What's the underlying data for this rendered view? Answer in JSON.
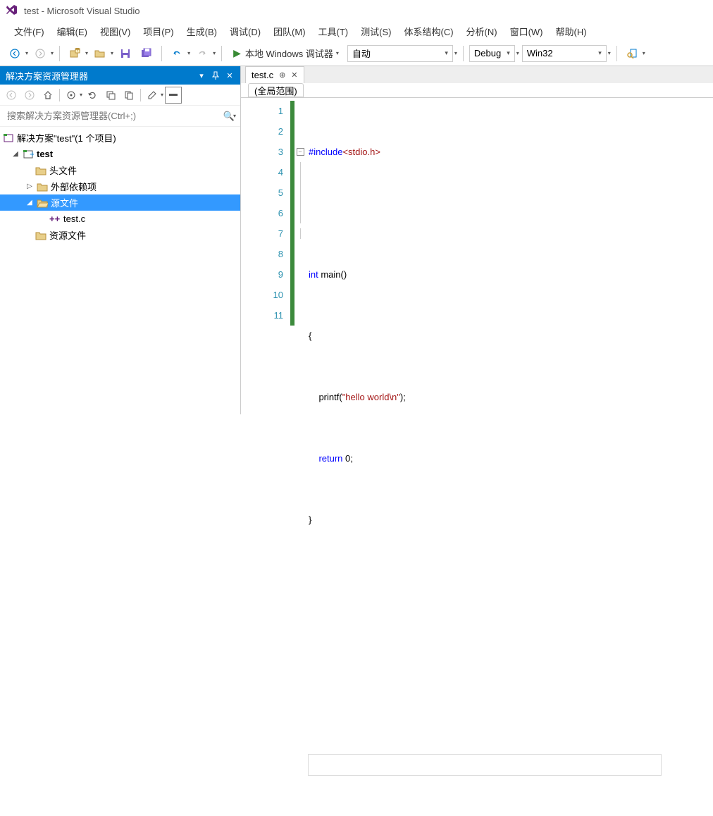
{
  "title": "test - Microsoft Visual Studio",
  "menu": [
    "文件(F)",
    "编辑(E)",
    "视图(V)",
    "项目(P)",
    "生成(B)",
    "调试(D)",
    "团队(M)",
    "工具(T)",
    "测试(S)",
    "体系结构(C)",
    "分析(N)",
    "窗口(W)",
    "帮助(H)"
  ],
  "toolbar": {
    "debugger_label": "本地 Windows 调试器",
    "combo1": "自动",
    "combo2": "Debug",
    "combo3": "Win32"
  },
  "solution_panel": {
    "title": "解决方案资源管理器",
    "search_placeholder": "搜索解决方案资源管理器(Ctrl+;)",
    "tree": {
      "solution": "解决方案\"test\"(1 个项目)",
      "project": "test",
      "headers": "头文件",
      "external": "外部依赖项",
      "sources": "源文件",
      "sourcefile": "test.c",
      "resources": "资源文件"
    }
  },
  "editor": {
    "tab_name": "test.c",
    "scope": "(全局范围)",
    "line_count": 11,
    "code": {
      "l1_pp": "#include",
      "l1_inc": "<stdio.h>",
      "l3_kw": "int",
      "l3_rest": " main()",
      "l4": "{",
      "l5_a": "    printf(",
      "l5_str": "\"hello world\\n\"",
      "l5_b": ");",
      "l6_kw": "    return",
      "l6_rest": " 0;",
      "l7": "}"
    }
  }
}
